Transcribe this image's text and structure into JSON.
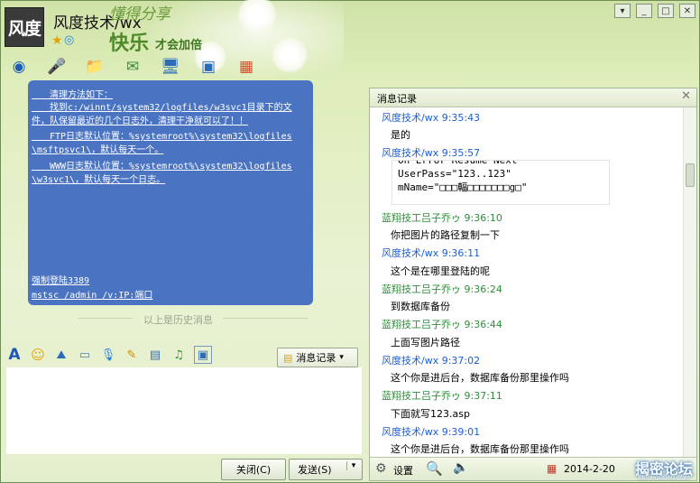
{
  "window": {
    "title": "风度技术/wx",
    "avatar_text": "风度",
    "slogan_line1": "懂得分享",
    "slogan_line2": "快乐",
    "slogan_line3": "才会加倍",
    "status_icons": [
      "star-icon",
      "qzone-icon"
    ],
    "controls": [
      "menu-icon",
      "minimize-icon",
      "maximize-icon",
      "close-icon"
    ]
  },
  "toolbar": [
    "video-call-icon",
    "voice-call-icon",
    "file-transfer-icon",
    "sms-icon",
    "remote-desktop-icon",
    "share-screen-icon",
    "apps-icon"
  ],
  "history": {
    "lines": [
      "　　清理方法如下：",
      "　　找到c:/winnt/system32/logfiles/w3svc1目录下的文",
      "件，队保留最近的几个日志外，清理干净就可以了！！",
      "　　FTP日志默认位置：%systemroot%\\system32\\logfiles",
      "\\msftpsvc1\\，默认每天一个。",
      "　　WWW日志默认位置：%systemroot%\\system32\\logfiles",
      "\\w3svc1\\，默认每天一个日志。"
    ],
    "bottom_lines": [
      "强制登陆3389",
      "mstsc /admin /v:IP:端口"
    ],
    "separator": "以上是历史消息"
  },
  "format_toolbar": [
    "font-icon",
    "emoji-icon",
    "shake-icon",
    "screenshot-icon",
    "voice-msg-icon",
    "handwrite-icon",
    "picture-icon",
    "music-icon",
    "screen-icon"
  ],
  "msg_record_button": "消息记录",
  "buttons": {
    "close": "关闭(C)",
    "send": "发送(S)"
  },
  "panel": {
    "title": "消息记录",
    "code_lines": [
      "On Error Resume Next",
      "UserPass=\"123..123\"",
      "mName=\"□□□輻□□□□□□□g□\""
    ],
    "entries": [
      {
        "name": "风度技术/wx  9:35:43",
        "msg": "是的",
        "color": "blue"
      },
      {
        "name": "风度技术/wx  9:35:57",
        "msg": "",
        "color": "blue"
      },
      {
        "name": "蓝翔技工吕子乔ゥ  9:36:10",
        "msg": "你把图片的路径复制一下",
        "color": "green"
      },
      {
        "name": "风度技术/wx  9:36:11",
        "msg": "这个是在哪里登陆的呢",
        "color": "blue"
      },
      {
        "name": "蓝翔技工吕子乔ゥ  9:36:24",
        "msg": "到数据库备份",
        "color": "green"
      },
      {
        "name": "蓝翔技工吕子乔ゥ  9:36:44",
        "msg": "上面写图片路径",
        "color": "green"
      },
      {
        "name": "风度技术/wx  9:37:02",
        "msg": "这个你是进后台，数据库备份那里操作吗",
        "color": "blue"
      },
      {
        "name": "蓝翔技工吕子乔ゥ  9:37:11",
        "msg": "下面就写123.asp",
        "color": "green"
      },
      {
        "name": "风度技术/wx  9:39:01",
        "msg": "这个你是进后台，数据库备份那里操作吗",
        "color": "blue"
      }
    ],
    "footer": {
      "settings": "设置",
      "date": "2014-2-20"
    },
    "watermark": "揭密论坛",
    "watermark_url": "BBS.HOUDAO.COM"
  }
}
